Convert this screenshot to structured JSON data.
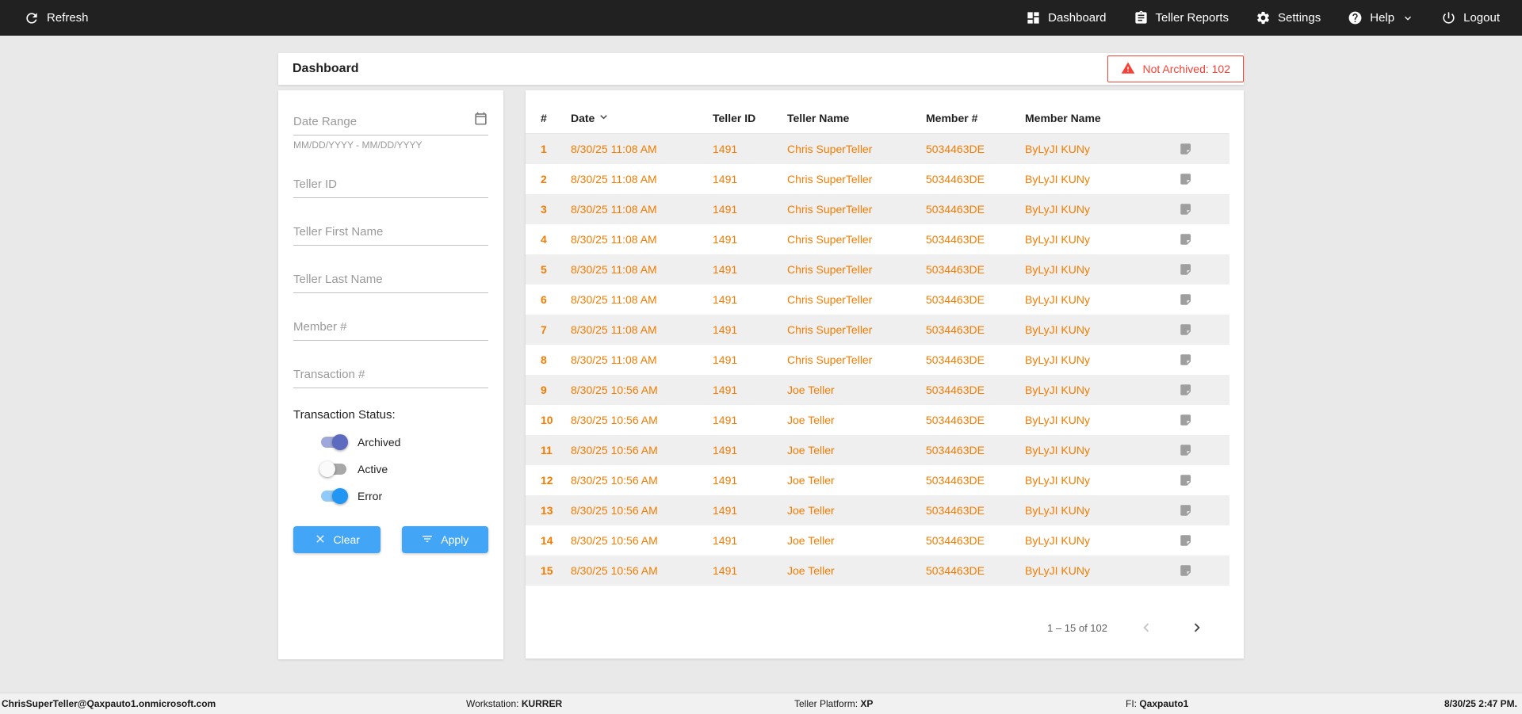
{
  "topbar": {
    "refresh_label": "Refresh",
    "nav": [
      {
        "label": "Dashboard"
      },
      {
        "label": "Teller Reports"
      },
      {
        "label": "Settings"
      },
      {
        "label": "Help"
      },
      {
        "label": "Logout"
      }
    ]
  },
  "header": {
    "title": "Dashboard",
    "alert": "Not Archived: 102"
  },
  "filters": {
    "date_range_placeholder": "Date Range",
    "date_range_hint": "MM/DD/YYYY - MM/DD/YYYY",
    "teller_id_placeholder": "Teller ID",
    "teller_first_placeholder": "Teller First Name",
    "teller_last_placeholder": "Teller Last Name",
    "member_placeholder": "Member #",
    "transaction_placeholder": "Transaction #",
    "status_label": "Transaction Status:",
    "toggles": [
      {
        "label": "Archived",
        "state": "on",
        "thumb": "#5c6bc0",
        "track": "#9fa8da"
      },
      {
        "label": "Active",
        "state": "off",
        "thumb": "#fafafa",
        "track": "#a8a8a8"
      },
      {
        "label": "Error",
        "state": "on",
        "thumb": "#2196f3",
        "track": "#90caf9"
      }
    ],
    "clear_label": "Clear",
    "apply_label": "Apply"
  },
  "table": {
    "columns": [
      "#",
      "Date",
      "Teller ID",
      "Teller Name",
      "Member #",
      "Member Name"
    ],
    "rows": [
      {
        "num": "1",
        "date": "8/30/25 11:08 AM",
        "teller_id": "1491",
        "teller_name": "Chris SuperTeller",
        "member_num": "5034463DE",
        "member_name": "ByLyJI KUNy"
      },
      {
        "num": "2",
        "date": "8/30/25 11:08 AM",
        "teller_id": "1491",
        "teller_name": "Chris SuperTeller",
        "member_num": "5034463DE",
        "member_name": "ByLyJI KUNy"
      },
      {
        "num": "3",
        "date": "8/30/25 11:08 AM",
        "teller_id": "1491",
        "teller_name": "Chris SuperTeller",
        "member_num": "5034463DE",
        "member_name": "ByLyJI KUNy"
      },
      {
        "num": "4",
        "date": "8/30/25 11:08 AM",
        "teller_id": "1491",
        "teller_name": "Chris SuperTeller",
        "member_num": "5034463DE",
        "member_name": "ByLyJI KUNy"
      },
      {
        "num": "5",
        "date": "8/30/25 11:08 AM",
        "teller_id": "1491",
        "teller_name": "Chris SuperTeller",
        "member_num": "5034463DE",
        "member_name": "ByLyJI KUNy"
      },
      {
        "num": "6",
        "date": "8/30/25 11:08 AM",
        "teller_id": "1491",
        "teller_name": "Chris SuperTeller",
        "member_num": "5034463DE",
        "member_name": "ByLyJI KUNy"
      },
      {
        "num": "7",
        "date": "8/30/25 11:08 AM",
        "teller_id": "1491",
        "teller_name": "Chris SuperTeller",
        "member_num": "5034463DE",
        "member_name": "ByLyJI KUNy"
      },
      {
        "num": "8",
        "date": "8/30/25 11:08 AM",
        "teller_id": "1491",
        "teller_name": "Chris SuperTeller",
        "member_num": "5034463DE",
        "member_name": "ByLyJI KUNy"
      },
      {
        "num": "9",
        "date": "8/30/25 10:56 AM",
        "teller_id": "1491",
        "teller_name": "Joe Teller",
        "member_num": "5034463DE",
        "member_name": "ByLyJI KUNy"
      },
      {
        "num": "10",
        "date": "8/30/25 10:56 AM",
        "teller_id": "1491",
        "teller_name": "Joe Teller",
        "member_num": "5034463DE",
        "member_name": "ByLyJI KUNy"
      },
      {
        "num": "11",
        "date": "8/30/25 10:56 AM",
        "teller_id": "1491",
        "teller_name": "Joe Teller",
        "member_num": "5034463DE",
        "member_name": "ByLyJI KUNy"
      },
      {
        "num": "12",
        "date": "8/30/25 10:56 AM",
        "teller_id": "1491",
        "teller_name": "Joe Teller",
        "member_num": "5034463DE",
        "member_name": "ByLyJI KUNy"
      },
      {
        "num": "13",
        "date": "8/30/25 10:56 AM",
        "teller_id": "1491",
        "teller_name": "Joe Teller",
        "member_num": "5034463DE",
        "member_name": "ByLyJI KUNy"
      },
      {
        "num": "14",
        "date": "8/30/25 10:56 AM",
        "teller_id": "1491",
        "teller_name": "Joe Teller",
        "member_num": "5034463DE",
        "member_name": "ByLyJI KUNy"
      },
      {
        "num": "15",
        "date": "8/30/25 10:56 AM",
        "teller_id": "1491",
        "teller_name": "Joe Teller",
        "member_num": "5034463DE",
        "member_name": "ByLyJI KUNy"
      }
    ],
    "pagination": "1 – 15 of 102"
  },
  "footer": {
    "user": "ChrisSuperTeller@Qaxpauto1.onmicrosoft.com",
    "workstation_label": "Workstation: ",
    "workstation_value": "KURRER",
    "platform_label": "Teller Platform: ",
    "platform_value": "XP",
    "fi_label": "FI: ",
    "fi_value": "Qaxpauto1",
    "datetime": "8/30/25 2:47 PM."
  },
  "colors": {
    "row_text_orange": "#F57C00",
    "button_blue": "#42A5F5",
    "alert_red": "#F44336",
    "topbar_dark": "#212121"
  }
}
